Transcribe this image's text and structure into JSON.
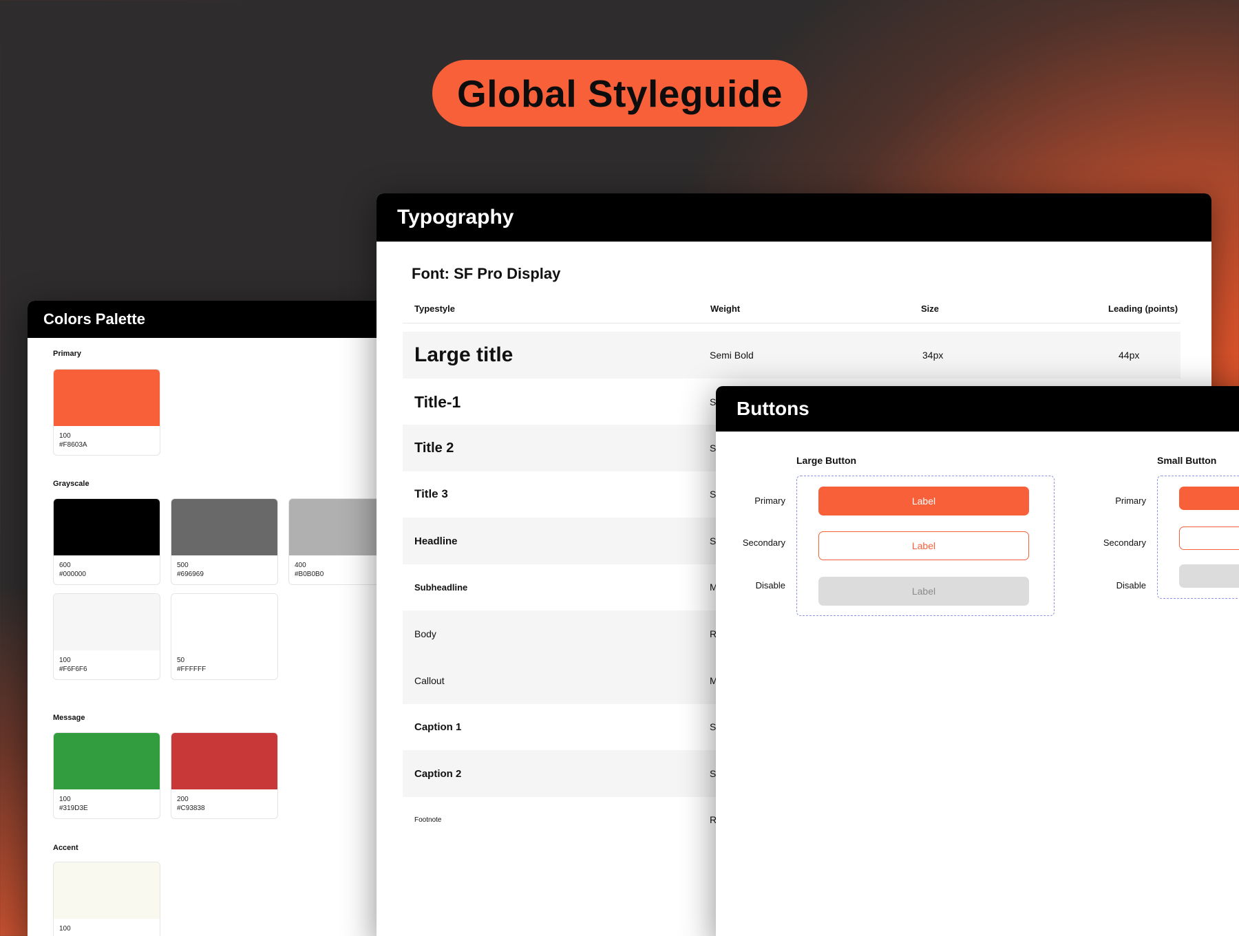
{
  "banner": {
    "title": "Global Styleguide"
  },
  "colors_panel": {
    "title": "Colors Palette",
    "sections": {
      "primary": {
        "label": "Primary",
        "swatches": [
          {
            "shade": "100",
            "hex": "#F8603A",
            "color": "#F8603A"
          }
        ]
      },
      "grayscale": {
        "label": "Grayscale",
        "swatches": [
          {
            "shade": "600",
            "hex": "#000000",
            "color": "#000000"
          },
          {
            "shade": "500",
            "hex": "#696969",
            "color": "#696969"
          },
          {
            "shade": "400",
            "hex": "#B0B0B0",
            "color": "#B0B0B0"
          },
          {
            "shade": "100",
            "hex": "#F6F6F6",
            "color": "#F6F6F6"
          },
          {
            "shade": "50",
            "hex": "#FFFFFF",
            "color": "#FFFFFF"
          }
        ]
      },
      "message": {
        "label": "Message",
        "swatches": [
          {
            "shade": "100",
            "hex": "#319D3E",
            "color": "#319D3E"
          },
          {
            "shade": "200",
            "hex": "#C93838",
            "color": "#C93838"
          }
        ]
      },
      "accent": {
        "label": "Accent",
        "swatches": [
          {
            "shade": "100",
            "color": "#FAF9F0"
          }
        ]
      }
    }
  },
  "typography_panel": {
    "title": "Typography",
    "font_label": "Font: SF Pro Display",
    "columns": {
      "typestyle": "Typestyle",
      "weight": "Weight",
      "size": "Size",
      "leading": "Leading (points)"
    },
    "rows": [
      {
        "name": "Large title",
        "weight": "Semi Bold",
        "size": "34px",
        "leading": "44px"
      },
      {
        "name": "Title-1",
        "weight": "S"
      },
      {
        "name": "Title 2",
        "weight": "S"
      },
      {
        "name": "Title 3",
        "weight": "S"
      },
      {
        "name": "Headline",
        "weight": "S"
      },
      {
        "name": "Subheadline",
        "weight": "M"
      },
      {
        "name": "Body",
        "weight": "R"
      },
      {
        "name": "Callout",
        "weight": "M"
      },
      {
        "name": "Caption 1",
        "weight": "S"
      },
      {
        "name": "Caption 2",
        "weight": "S"
      },
      {
        "name": "Footnote",
        "weight": "R"
      }
    ]
  },
  "buttons_panel": {
    "title": "Buttons",
    "large": {
      "title": "Large Button",
      "rows": [
        {
          "label": "Primary",
          "button": "Label"
        },
        {
          "label": "Secondary",
          "button": "Label"
        },
        {
          "label": "Disable",
          "button": "Label"
        }
      ]
    },
    "small": {
      "title": "Small Button",
      "rows": [
        {
          "label": "Primary"
        },
        {
          "label": "Secondary"
        },
        {
          "label": "Disable"
        }
      ]
    }
  },
  "theme": {
    "accent": "#F8603A",
    "dashed_border": "#8F93E8",
    "background": "#2E2C2C"
  }
}
